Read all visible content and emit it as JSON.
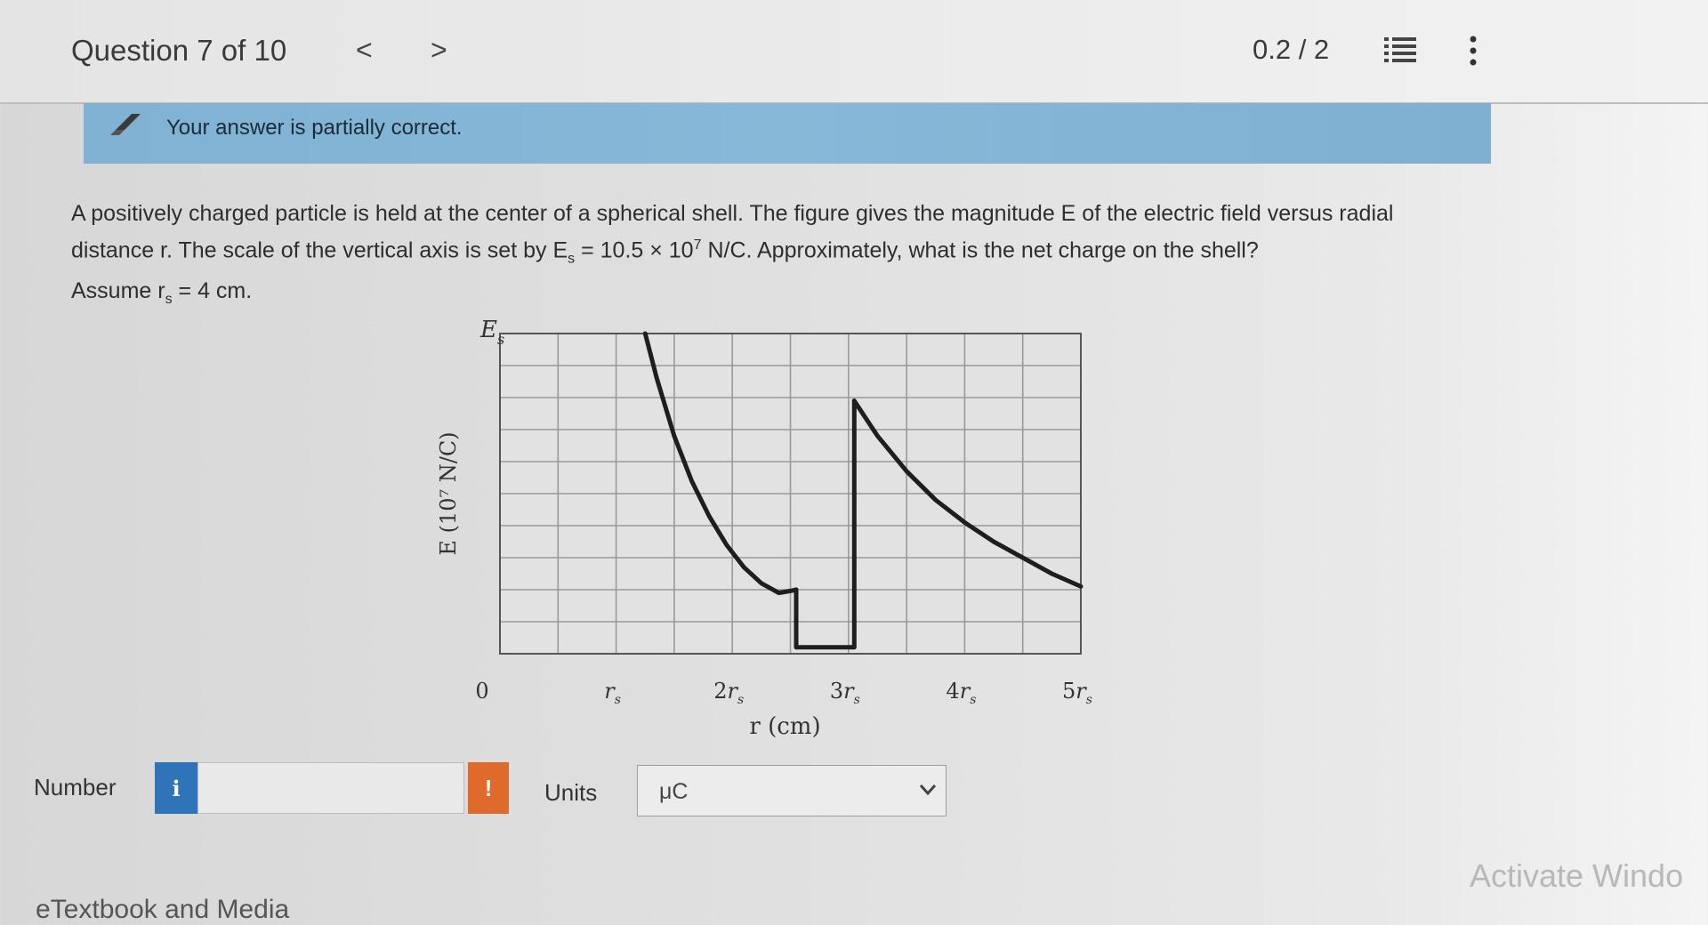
{
  "header": {
    "title": "Question 7 of 10",
    "prev_label": "<",
    "next_label": ">",
    "score": "0.2 / 2"
  },
  "feedback": {
    "message": "Your answer is partially correct."
  },
  "question": {
    "line1": "A positively charged particle is held at the center of a spherical shell. The figure gives the magnitude E of the electric field versus radial",
    "line2_pre": "distance r. The scale of the vertical axis is set by E",
    "line2_sub": "s",
    "line2_mid": " = 10.5 × 10",
    "line2_sup": "7",
    "line2_post": " N/C. Approximately, what is the net charge on the shell?",
    "line3_pre": "Assume r",
    "line3_sub": "s",
    "line3_post": " = 4 cm."
  },
  "chart_data": {
    "type": "line",
    "ylabel": "E (10⁷ N/C)",
    "xlabel": "r (cm)",
    "ytop_label": "Es",
    "ytop_label_parts": [
      "E",
      "s"
    ],
    "origin_label": "0",
    "x_tick_labels": [
      {
        "at": 1,
        "parts": [
          "",
          "r",
          "s"
        ]
      },
      {
        "at": 2,
        "parts": [
          "2",
          "r",
          "s"
        ]
      },
      {
        "at": 3,
        "parts": [
          "3",
          "r",
          "s"
        ]
      },
      {
        "at": 4,
        "parts": [
          "4",
          "r",
          "s"
        ]
      },
      {
        "at": 5,
        "parts": [
          "5",
          "r",
          "s"
        ]
      }
    ],
    "xlim": [
      0,
      5
    ],
    "ylim": [
      0,
      1
    ],
    "x_minor_divisions": 10,
    "y_minor_divisions": 10,
    "grid": true,
    "series": [
      {
        "segment": "inside",
        "x": [
          1.25,
          1.35,
          1.5,
          1.65,
          1.8,
          1.95,
          2.1,
          2.25,
          2.4,
          2.5,
          2.55
        ],
        "y": [
          1.0,
          0.86,
          0.68,
          0.54,
          0.43,
          0.34,
          0.27,
          0.22,
          0.19,
          0.196,
          0.2
        ]
      },
      {
        "segment": "inside-shell",
        "x": [
          2.55,
          2.55,
          3.05,
          3.05
        ],
        "y": [
          0.2,
          0.02,
          0.02,
          0.79
        ]
      },
      {
        "segment": "outside",
        "x": [
          3.05,
          3.25,
          3.5,
          3.75,
          4.0,
          4.25,
          4.5,
          4.75,
          5.0
        ],
        "y": [
          0.79,
          0.68,
          0.57,
          0.48,
          0.41,
          0.35,
          0.3,
          0.25,
          0.21
        ]
      }
    ]
  },
  "answer": {
    "number_label": "Number",
    "info_label": "i",
    "number_value": "",
    "alert_label": "!",
    "units_label": "Units",
    "units_value": "μC"
  },
  "footer": {
    "etextbook_label": "eTextbook and Media",
    "watermark": "Activate Windo"
  },
  "colors": {
    "banner": "#86b8d8",
    "info_button": "#2d75b8",
    "alert": "#e06a2c"
  }
}
